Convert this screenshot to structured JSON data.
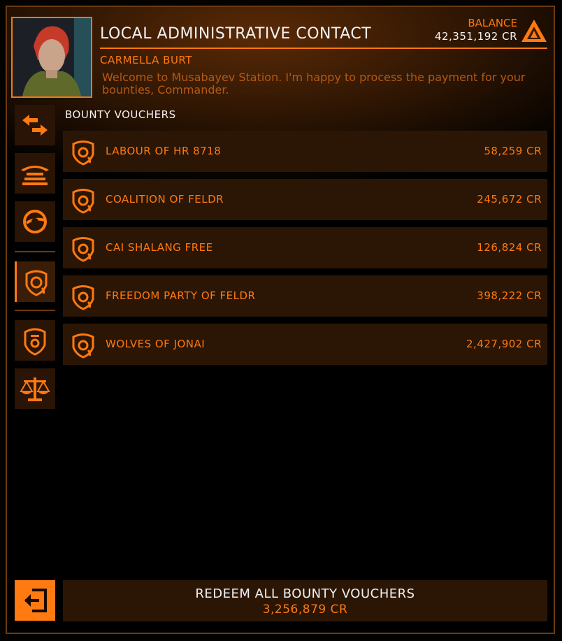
{
  "header": {
    "title": "LOCAL ADMINISTRATIVE CONTACT",
    "contact_name": "CARMELLA BURT",
    "welcome": "Welcome to Musabayev Station. I'm happy to process the payment for your bounties, Commander.",
    "balance_label": "BALANCE",
    "balance_value": "42,351,192 CR",
    "faction_icon": "triangle-faction-icon"
  },
  "sidebar": {
    "items": [
      {
        "name": "transfer-icon",
        "active": false
      },
      {
        "name": "search-and-rescue-icon",
        "active": false
      },
      {
        "name": "exploration-icon",
        "active": false
      },
      {
        "name": "bounty-icon",
        "active": true
      },
      {
        "name": "badge-icon",
        "active": false
      },
      {
        "name": "scales-icon",
        "active": false
      }
    ]
  },
  "main": {
    "section_title": "BOUNTY VOUCHERS",
    "vouchers": [
      {
        "name": "LABOUR OF HR 8718",
        "amount": "58,259 CR"
      },
      {
        "name": "COALITION OF FELDR",
        "amount": "245,672 CR"
      },
      {
        "name": "CAI SHALANG FREE",
        "amount": "126,824 CR"
      },
      {
        "name": "FREEDOM PARTY OF FELDR",
        "amount": "398,222 CR"
      },
      {
        "name": "WOLVES OF JONAI",
        "amount": "2,427,902 CR"
      }
    ]
  },
  "footer": {
    "exit_icon": "exit-icon",
    "redeem_label": "REDEEM ALL BOUNTY VOUCHERS",
    "redeem_total": "3,256,879 CR"
  },
  "colors": {
    "accent": "#ff7a10",
    "panel": "#2b1605",
    "text": "#f2f2f2"
  }
}
